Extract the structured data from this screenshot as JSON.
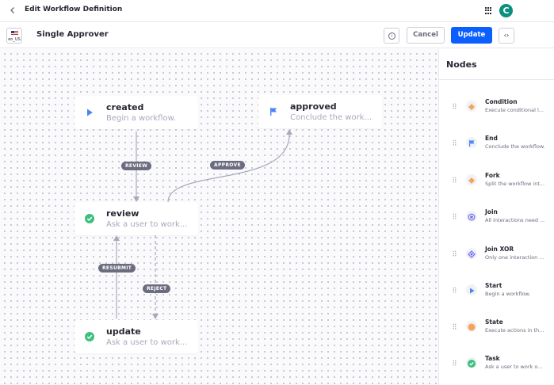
{
  "header": {
    "title": "Edit Workflow Definition",
    "avatar_letter": "C"
  },
  "toolbar": {
    "locale": "en_US",
    "definition_title": "Single Approver",
    "info_icon": "i",
    "cancel_label": "Cancel",
    "update_label": "Update",
    "code_icon": "‹›"
  },
  "canvas": {
    "nodes": {
      "created": {
        "title": "created",
        "description": "Begin a workflow."
      },
      "approved": {
        "title": "approved",
        "description": "Conclude the work..."
      },
      "review": {
        "title": "review",
        "description": "Ask a user to work..."
      },
      "update": {
        "title": "update",
        "description": "Ask a user to work..."
      }
    },
    "transitions": {
      "review": "REVIEW",
      "approve": "APPROVE",
      "resubmit": "RESUBMIT",
      "reject": "REJECT"
    }
  },
  "panel": {
    "title": "Nodes",
    "items": [
      {
        "title": "Condition",
        "description": "Execute conditional l...",
        "icon": "diamond-icon",
        "color": "#f5a55b"
      },
      {
        "title": "End",
        "description": "Conclude the workflow.",
        "icon": "flag-icon",
        "color": "#4b84fa"
      },
      {
        "title": "Fork",
        "description": "Split the workflow int...",
        "icon": "diamond-icon",
        "color": "#f5a55b"
      },
      {
        "title": "Join",
        "description": "All interactions need ...",
        "icon": "circle-dot-icon",
        "color": "#6e6ef2"
      },
      {
        "title": "Join XOR",
        "description": "Only one interaction ...",
        "icon": "diamond-dot-icon",
        "color": "#6e6ef2"
      },
      {
        "title": "Start",
        "description": "Begin a workflow.",
        "icon": "play-icon",
        "color": "#4b84fa"
      },
      {
        "title": "State",
        "description": "Execute actions in th...",
        "icon": "circle-icon",
        "color": "#f5a55b"
      },
      {
        "title": "Task",
        "description": "Ask a user to work o...",
        "icon": "check-icon",
        "color": "#3dbf7e"
      }
    ]
  },
  "colors": {
    "primary": "#0b5fff",
    "start": "#4b84fa",
    "task": "#3dbf7e",
    "state": "#f5a55b",
    "join": "#6e6ef2"
  }
}
